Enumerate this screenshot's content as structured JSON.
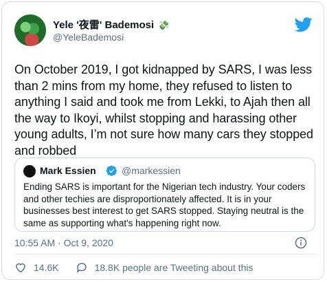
{
  "author": {
    "name": "Yele '夜雷' Bademosi",
    "emoji": "💸",
    "handle": "@YeleBademosi"
  },
  "tweet": {
    "text": "On October 2019, I got kidnapped by SARS, I was less than 2 mins from my home, they refused to listen to anything I said and took me from Lekki, to Ajah then all the way to Ikoyi, whilst stopping and harassing other young adults, I’m not sure how many cars they stopped and robbed"
  },
  "quote": {
    "name": "Mark Essien",
    "handle": "@markessien",
    "text": "Ending SARS is important for the Nigerian tech industry. Your coders and other techies are disproportionately affected. It is in your businesses best interest to get SARS stopped. Staying neutral is the same as supporting what's happening right now."
  },
  "meta": {
    "timestamp": "10:55 AM · Oct 9, 2020"
  },
  "stats": {
    "likes": "14.6K",
    "tweeting": "18.8K people are Tweeting about this"
  },
  "colors": {
    "brand": "#1da1f2",
    "secondary_text": "#5b7083",
    "border": "#d6dde2"
  },
  "icons": [
    "twitter-logo-icon",
    "verified-badge-icon",
    "info-icon",
    "heart-icon",
    "comment-icon"
  ]
}
